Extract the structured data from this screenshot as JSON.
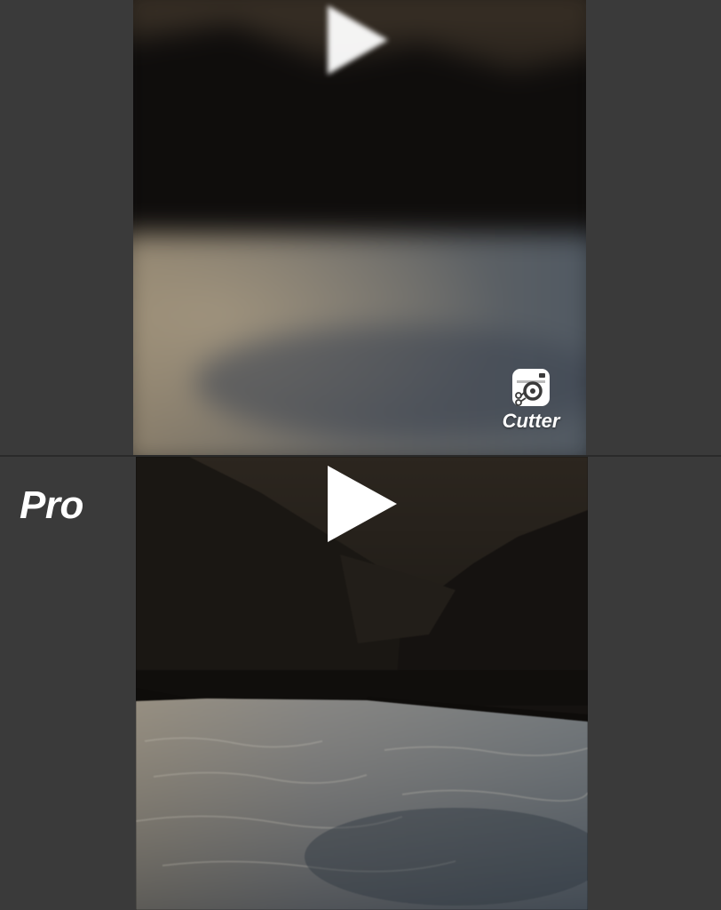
{
  "layout": "before-after-comparison",
  "colors": {
    "background": "#3a3a3a",
    "divider": "#2a2a2a",
    "label": "#ffffff",
    "sky": "#2a2520",
    "mountains": "#15120f",
    "water": "#6f7378"
  },
  "top_panel": {
    "video": {
      "state": "blurred",
      "play_icon": "play-icon"
    },
    "watermark": {
      "icon": "camera-scissors-icon",
      "label": "Cutter"
    }
  },
  "bottom_panel": {
    "label": "Pro",
    "video": {
      "state": "sharp",
      "play_icon": "play-icon"
    }
  }
}
